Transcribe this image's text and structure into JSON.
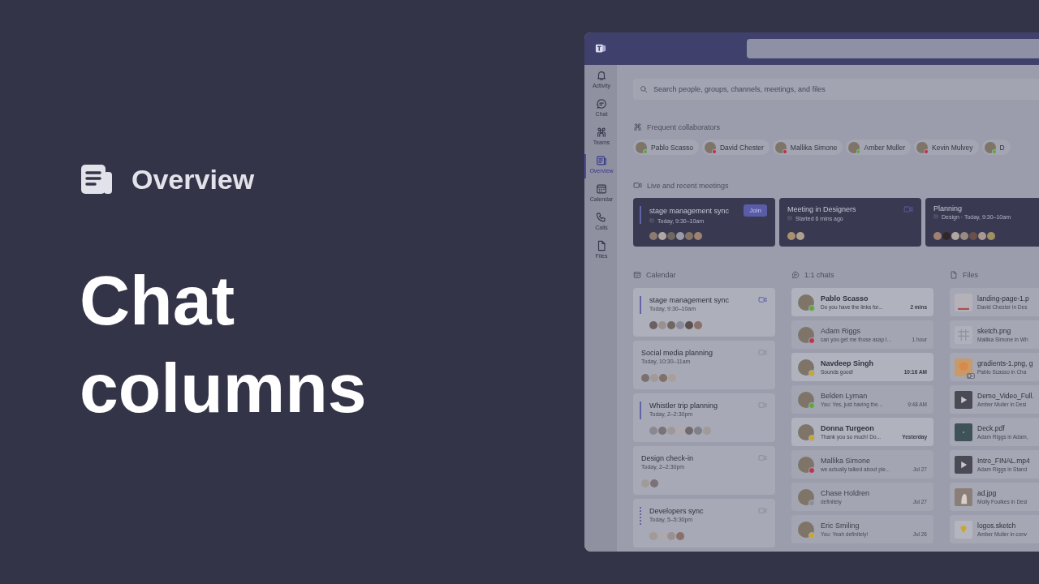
{
  "slide": {
    "section": "Overview",
    "title": "Chat columns"
  },
  "app": {
    "search": {
      "placeholder": "Search people, groups, channels, meetings, and files"
    },
    "rail": [
      {
        "label": "Activity",
        "selected": false
      },
      {
        "label": "Chat",
        "selected": false
      },
      {
        "label": "Teams",
        "selected": false
      },
      {
        "label": "Overview",
        "selected": true
      },
      {
        "label": "Calendar",
        "selected": false
      },
      {
        "label": "Calls",
        "selected": false
      },
      {
        "label": "Files",
        "selected": false
      }
    ],
    "collaborators": {
      "heading": "Frequent collaborators",
      "people": [
        {
          "name": "Pablo Scasso",
          "color": "#5fa83a"
        },
        {
          "name": "David Chester",
          "color": "#b9344d"
        },
        {
          "name": "Mallika Simone",
          "color": "#b9344d"
        },
        {
          "name": "Amber Muller",
          "color": "#5fa83a"
        },
        {
          "name": "Kevin Mulvey",
          "color": "#b9344d"
        },
        {
          "name": "D",
          "color": "#5fa83a"
        }
      ]
    },
    "meetings": {
      "heading": "Live and recent meetings",
      "items": [
        {
          "title": "stage management sync",
          "detail": "Today, 9:30–10am",
          "live": true,
          "action": "Join",
          "avatars": [
            {
              "color": "#8a7a70"
            },
            {
              "color": "#b0a8a0"
            },
            {
              "color": "#706860"
            },
            {
              "color": "#9a9aa8"
            },
            {
              "color": "#857565"
            },
            {
              "color": "#a08070"
            }
          ]
        },
        {
          "title": "Meeting in Designers",
          "detail": "Started 6 mins ago",
          "live": false,
          "video": true,
          "avatars": [
            {
              "color": "#a89070"
            },
            {
              "color": "#b0a090"
            }
          ]
        },
        {
          "title": "Planning",
          "detail": "Design · Today, 9:30–10am",
          "live": false,
          "avatars": [
            {
              "color": "#a08070"
            },
            {
              "color": "#302828"
            },
            {
              "color": "#b0a8a0"
            },
            {
              "color": "#9a8a80"
            },
            {
              "color": "#6a5048"
            },
            {
              "color": "#a89890"
            },
            {
              "color": "#a09060"
            }
          ]
        }
      ]
    },
    "calendar": {
      "heading": "Calendar",
      "events": [
        {
          "kind": "marked",
          "title": "stage management sync",
          "time": "Today, 9:30–10am",
          "video_active": true,
          "avatars": [
            {
              "color": "#6a6060"
            },
            {
              "color": "#9a9090"
            },
            {
              "color": "#706860"
            },
            {
              "color": "#8a8a98"
            },
            {
              "color": "#5a5050"
            },
            {
              "color": "#8a7068"
            }
          ]
        },
        {
          "kind": "plain",
          "title": "Social media planning",
          "time": "Today, 10:30–11am",
          "video_active": false,
          "avatars": [
            {
              "color": "#7a7070"
            },
            {
              "color": "#a09a98"
            },
            {
              "color": "#807068"
            },
            {
              "color": "#a8a098"
            }
          ]
        },
        {
          "kind": "marked",
          "title": "Whistler trip planning",
          "time": "Today, 2–2:30pm",
          "video_active": false,
          "avatars": [
            {
              "color": "#8a8890"
            },
            {
              "color": "#7a7278"
            },
            {
              "color": "#a09898"
            },
            {
              "color": "#b0a8a8"
            },
            {
              "color": "#706a70"
            },
            {
              "color": "#808088"
            },
            {
              "color": "#a09a9a"
            }
          ]
        },
        {
          "kind": "plain",
          "title": "Design check-in",
          "time": "Today, 2–2:30pm",
          "video_active": false,
          "avatars": [
            {
              "color": "#a09a98"
            },
            {
              "color": "#7a7278"
            }
          ]
        },
        {
          "kind": "dotted",
          "title": "Developers sync",
          "time": "Today, 5–5:30pm",
          "video_active": false,
          "avatars": [
            {
              "color": "#a09a98"
            },
            {
              "color": "#b0a8a8"
            },
            {
              "color": "#9a9090"
            },
            {
              "color": "#8a7068"
            }
          ]
        }
      ]
    },
    "chats": {
      "heading": "1:1 chats",
      "items": [
        {
          "name": "Pablo Scasso",
          "preview": "Do you have the links for...",
          "time": "2 mins",
          "unread": true,
          "color": "#5fa83a"
        },
        {
          "name": "Adam Riggs",
          "preview": "can you get me those asap I...",
          "time": "1 hour",
          "unread": false,
          "color": "#b9344d"
        },
        {
          "name": "Navdeep Singh",
          "preview": "Sounds good!",
          "time": "10:16 AM",
          "unread": true,
          "color": "#c9a830"
        },
        {
          "name": "Belden Lyman",
          "preview": "You: Yes, just having the...",
          "time": "9:48 AM",
          "unread": false,
          "color": "#5fa83a"
        },
        {
          "name": "Donna Turgeon",
          "preview": "Thank you so much! Do...",
          "time": "Yesterday",
          "unread": true,
          "color": "#c9a830"
        },
        {
          "name": "Mallika Simone",
          "preview": "we actually talked about ple...",
          "time": "Jul 27",
          "unread": false,
          "color": "#b9344d"
        },
        {
          "name": "Chase Holdren",
          "preview": "definitely",
          "time": "Jul 27",
          "unread": false,
          "color": "#8c8e9a"
        },
        {
          "name": "Eric Smiling",
          "preview": "You: Yeah definitely!",
          "time": "Jul 26",
          "unread": false,
          "color": "#c9a830"
        }
      ]
    },
    "files": {
      "heading": "Files",
      "items": [
        {
          "name": "landing-page-1.p",
          "detail": "David Chester in Des",
          "kind": "document"
        },
        {
          "name": "sketch.png",
          "detail": "Mallika Simone in Wh",
          "kind": "grid"
        },
        {
          "name": "gradients-1.png, g",
          "detail": "Pablo Scasso in Cha",
          "kind": "image",
          "badge": "+3"
        },
        {
          "name": "Demo_Video_Full.",
          "detail": "Amber Muller in Desi",
          "kind": "video"
        },
        {
          "name": "Deck.pdf",
          "detail": "Adam Riggs in Adam,",
          "kind": "pdf"
        },
        {
          "name": "Intro_FINAL.mp4",
          "detail": "Adam Riggs in Stand",
          "kind": "video"
        },
        {
          "name": "ad.jpg",
          "detail": "Molly Foulkes in Desi",
          "kind": "photo"
        },
        {
          "name": "logos.sketch",
          "detail": "Amber Muller in conv",
          "kind": "sketch"
        }
      ]
    }
  }
}
